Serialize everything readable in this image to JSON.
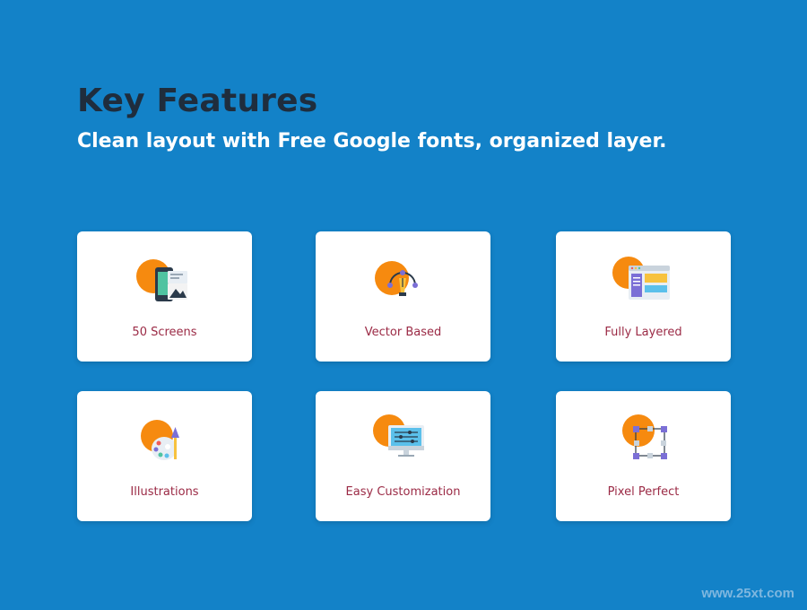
{
  "header": {
    "title": "Key Features",
    "subtitle": "Clean layout with Free Google fonts, organized layer."
  },
  "features": [
    {
      "label": "50 Screens",
      "icon": "mobile-screens-icon"
    },
    {
      "label": "Vector Based",
      "icon": "vector-pen-icon"
    },
    {
      "label": "Fully Layered",
      "icon": "layered-window-icon"
    },
    {
      "label": "Illustrations",
      "icon": "palette-icon"
    },
    {
      "label": "Easy Customization",
      "icon": "monitor-sliders-icon"
    },
    {
      "label": "Pixel Perfect",
      "icon": "pixel-grid-icon"
    }
  ],
  "watermark": "www.25xt.com",
  "colors": {
    "background": "#1382c8",
    "title": "#1f2d3d",
    "accent_orange": "#f68a0f",
    "label": "#9b2a45"
  }
}
